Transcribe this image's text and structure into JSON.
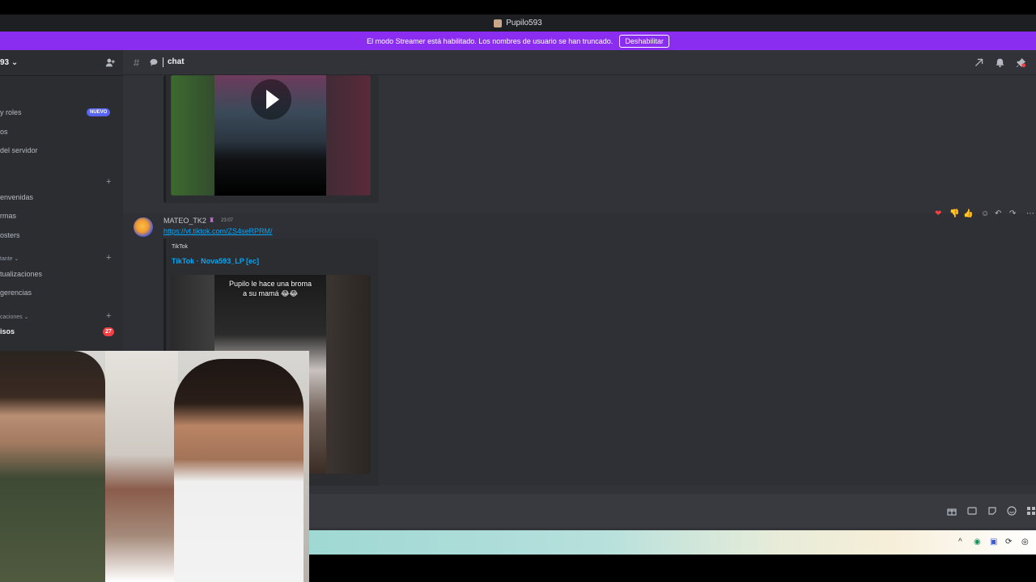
{
  "titlebar": {
    "title": "Pupilo593"
  },
  "streamer_banner": {
    "message": "El modo Streamer está habilitado. Los nombres de usuario se han truncado.",
    "button": "Deshabilitar"
  },
  "sidebar": {
    "server_name": "93 ⌄",
    "items": [
      {
        "label": "y roles"
      },
      {
        "label": "os"
      },
      {
        "label": "del servidor"
      },
      {
        "label": "envenidas"
      },
      {
        "label": "rmas"
      },
      {
        "label": "osters"
      },
      {
        "label": "tualizaciones"
      },
      {
        "label": "gerencias"
      },
      {
        "label": "isos"
      }
    ],
    "categories": [
      {
        "label": "tante ⌄"
      },
      {
        "label": "caciones ⌄"
      }
    ],
    "new_badge": "NUEVO",
    "unread_count": "27"
  },
  "channel": {
    "name": "chat"
  },
  "message": {
    "author": "MATEO_TK2",
    "author_icon": "♜",
    "timestamp": "23:07",
    "link": "https://vt.tiktok.com/ZS4seRPRM/",
    "embed": {
      "provider": "TikTok",
      "title": "TikTok · Nova593_LP [ec]",
      "caption_line1": "Pupilo le hace una broma",
      "caption_line2": "a su mamá 😂😂"
    }
  },
  "colors": {
    "banner": "#8b2df0",
    "link": "#00a8fc",
    "channel_bg": "#313338",
    "sidebar_bg": "#2b2d31"
  }
}
